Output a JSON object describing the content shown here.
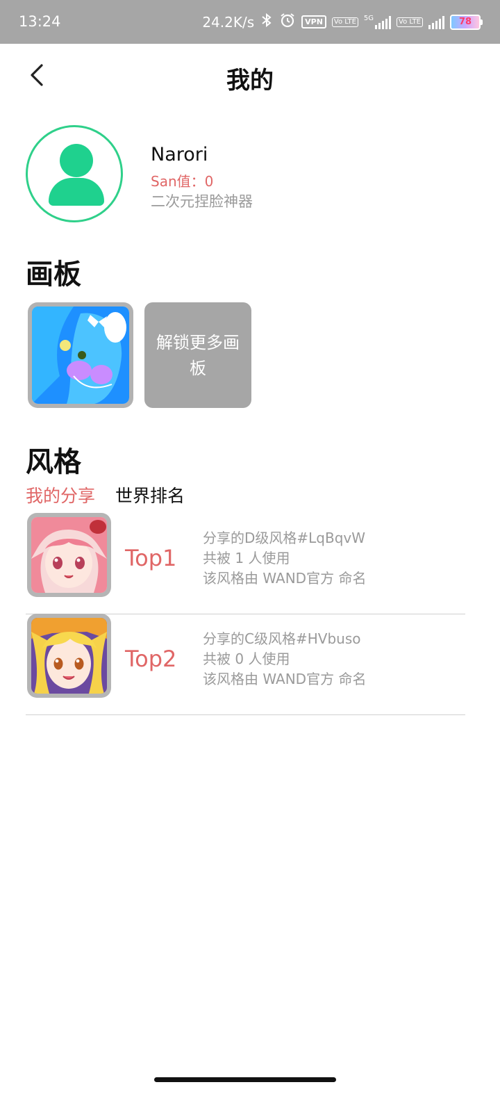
{
  "status_bar": {
    "time": "13:24",
    "net_speed": "24.2K/s",
    "vpn": "VPN",
    "volte": "Vo LTE",
    "network_5g": "5G",
    "battery": "78"
  },
  "header": {
    "title": "我的"
  },
  "profile": {
    "name": "Narori",
    "san_label": "San值：",
    "san_value": "0",
    "bio": "二次元捏脸神器"
  },
  "boards": {
    "title": "画板",
    "unlock_label": "解锁更多画板"
  },
  "styles": {
    "title": "风格",
    "tabs": [
      "我的分享",
      "世界排名"
    ],
    "active_tab": "我的分享",
    "items": [
      {
        "rank": "Top1",
        "line1": "分享的D级风格#LqBqvW",
        "line2": "共被 1 人使用",
        "line3": "该风格由 WAND官方 命名"
      },
      {
        "rank": "Top2",
        "line1": "分享的C级风格#HVbuso",
        "line2": "共被 0 人使用",
        "line3": "该风格由 WAND官方 命名"
      }
    ]
  },
  "colors": {
    "accent_red": "#e06666",
    "avatar_green": "#1fd18e",
    "status_bar": "#a6a6a6",
    "muted_text": "#9a9a9a"
  }
}
